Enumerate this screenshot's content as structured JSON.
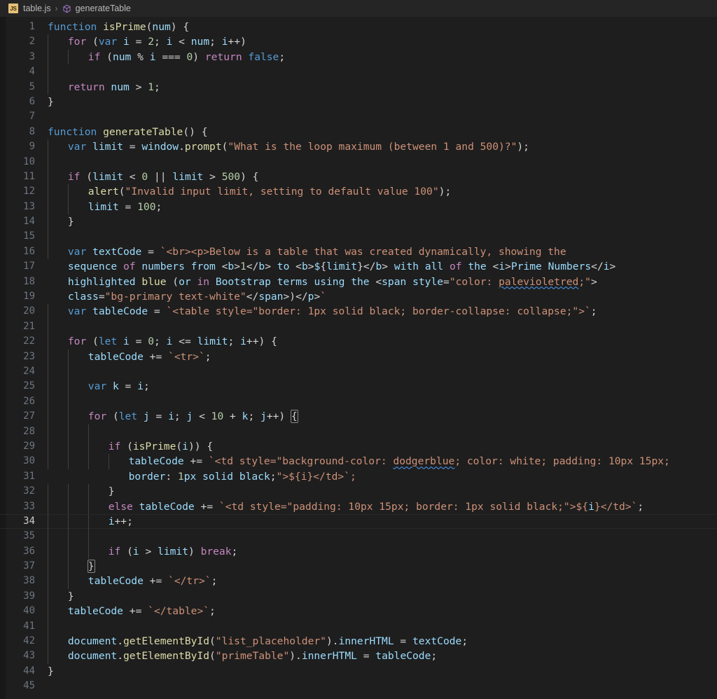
{
  "breadcrumb": {
    "file_icon": "js-file-icon",
    "file_icon_label": "JS",
    "file_name": "table.js",
    "separator": "›",
    "symbol_icon": "cube-symbol-icon",
    "symbol_name": "generateTable"
  },
  "editor": {
    "language": "javascript",
    "active_line": 34,
    "total_lines_visible": 45,
    "colors": {
      "background": "#1e1e1e",
      "gutter_text": "#6e7681",
      "active_line_number": "#cccccc",
      "keyword": "#569cd6",
      "control": "#c586c0",
      "function": "#dcdcaa",
      "variable": "#9cdcfe",
      "number": "#b5cea8",
      "string": "#ce9178",
      "plain": "#d4d4d4",
      "indent_guide": "#404040",
      "squiggle": "#4a9eff"
    },
    "lines": [
      {
        "n": 1,
        "indent": 0,
        "guides": 0,
        "text": "function isPrime(num) {"
      },
      {
        "n": 2,
        "indent": 1,
        "guides": 1,
        "text": "for (var i = 2; i < num; i++)"
      },
      {
        "n": 3,
        "indent": 2,
        "guides": 2,
        "text": "if (num % i === 0) return false;"
      },
      {
        "n": 4,
        "indent": 0,
        "guides": 1,
        "text": ""
      },
      {
        "n": 5,
        "indent": 1,
        "guides": 1,
        "text": "return num > 1;"
      },
      {
        "n": 6,
        "indent": 0,
        "guides": 0,
        "text": "}"
      },
      {
        "n": 7,
        "indent": 0,
        "guides": 0,
        "text": ""
      },
      {
        "n": 8,
        "indent": 0,
        "guides": 0,
        "text": "function generateTable() {"
      },
      {
        "n": 9,
        "indent": 1,
        "guides": 1,
        "text": "var limit = window.prompt(\"What is the loop maximum (between 1 and 500)?\");"
      },
      {
        "n": 10,
        "indent": 0,
        "guides": 1,
        "text": ""
      },
      {
        "n": 11,
        "indent": 1,
        "guides": 1,
        "text": "if (limit < 0 || limit > 500) {"
      },
      {
        "n": 12,
        "indent": 2,
        "guides": 2,
        "text": "alert(\"Invalid input limit, setting to default value 100\");"
      },
      {
        "n": 13,
        "indent": 2,
        "guides": 2,
        "text": "limit = 100;"
      },
      {
        "n": 14,
        "indent": 1,
        "guides": 1,
        "text": "}"
      },
      {
        "n": 15,
        "indent": 0,
        "guides": 1,
        "text": ""
      },
      {
        "n": 16,
        "indent": 1,
        "guides": 1,
        "text": "var textCode = `<br><p>Below is a table that was created dynamically, showing the"
      },
      {
        "n": 17,
        "indent": 1,
        "guides": 0,
        "text": "sequence of numbers from <b>1</b> to <b>${limit}</b> with all of the <i>Prime Numbers</i>"
      },
      {
        "n": 18,
        "indent": 1,
        "guides": 0,
        "text": "highlighted blue (or in Bootstrap terms using the <span style=\"color: palevioletred;\">"
      },
      {
        "n": 19,
        "indent": 1,
        "guides": 0,
        "text": "class=\"bg-primary text-white\"</span>)</p>`"
      },
      {
        "n": 20,
        "indent": 1,
        "guides": 1,
        "text": "var tableCode = `<table style=\"border: 1px solid black; border-collapse: collapse;\">`;"
      },
      {
        "n": 21,
        "indent": 0,
        "guides": 1,
        "text": ""
      },
      {
        "n": 22,
        "indent": 1,
        "guides": 1,
        "text": "for (let i = 0; i <= limit; i++) {"
      },
      {
        "n": 23,
        "indent": 2,
        "guides": 2,
        "text": "tableCode += `<tr>`;"
      },
      {
        "n": 24,
        "indent": 0,
        "guides": 2,
        "text": ""
      },
      {
        "n": 25,
        "indent": 2,
        "guides": 2,
        "text": "var k = i;"
      },
      {
        "n": 26,
        "indent": 0,
        "guides": 2,
        "text": ""
      },
      {
        "n": 27,
        "indent": 2,
        "guides": 2,
        "text": "for (let j = i; j < 10 + k; j++) {"
      },
      {
        "n": 28,
        "indent": 0,
        "guides": 3,
        "text": ""
      },
      {
        "n": 29,
        "indent": 3,
        "guides": 3,
        "text": "if (isPrime(i)) {"
      },
      {
        "n": 30,
        "indent": 4,
        "guides": 4,
        "text": "tableCode += `<td style=\"background-color: dodgerblue; color: white; padding: 10px 15px;"
      },
      {
        "n": 31,
        "indent": 4,
        "guides": 0,
        "text": "border: 1px solid black;\">${i}</td>`;"
      },
      {
        "n": 32,
        "indent": 3,
        "guides": 3,
        "text": "}"
      },
      {
        "n": 33,
        "indent": 3,
        "guides": 3,
        "text": "else tableCode += `<td style=\"padding: 10px 15px; border: 1px solid black;\">${i}</td>`;"
      },
      {
        "n": 34,
        "indent": 3,
        "guides": 3,
        "text": "i++;"
      },
      {
        "n": 35,
        "indent": 0,
        "guides": 3,
        "text": ""
      },
      {
        "n": 36,
        "indent": 3,
        "guides": 3,
        "text": "if (i > limit) break;"
      },
      {
        "n": 37,
        "indent": 2,
        "guides": 2,
        "text": "}"
      },
      {
        "n": 38,
        "indent": 2,
        "guides": 2,
        "text": "tableCode += `</tr>`;"
      },
      {
        "n": 39,
        "indent": 1,
        "guides": 1,
        "text": "}"
      },
      {
        "n": 40,
        "indent": 1,
        "guides": 1,
        "text": "tableCode += `</table>`;"
      },
      {
        "n": 41,
        "indent": 0,
        "guides": 1,
        "text": ""
      },
      {
        "n": 42,
        "indent": 1,
        "guides": 1,
        "text": "document.getElementById(\"list_placeholder\").innerHTML = textCode;"
      },
      {
        "n": 43,
        "indent": 1,
        "guides": 1,
        "text": "document.getElementById(\"primeTable\").innerHTML = tableCode;"
      },
      {
        "n": 44,
        "indent": 0,
        "guides": 0,
        "text": "}"
      },
      {
        "n": 45,
        "indent": 0,
        "guides": 0,
        "text": ""
      }
    ],
    "markers": [
      {
        "line": 18,
        "word": "palevioletred",
        "type": "spell-squiggle"
      },
      {
        "line": 30,
        "word": "dodgerblue",
        "type": "spell-squiggle"
      },
      {
        "line": 27,
        "word": "{",
        "type": "bracket-match"
      },
      {
        "line": 37,
        "word": "}",
        "type": "bracket-match"
      }
    ]
  }
}
